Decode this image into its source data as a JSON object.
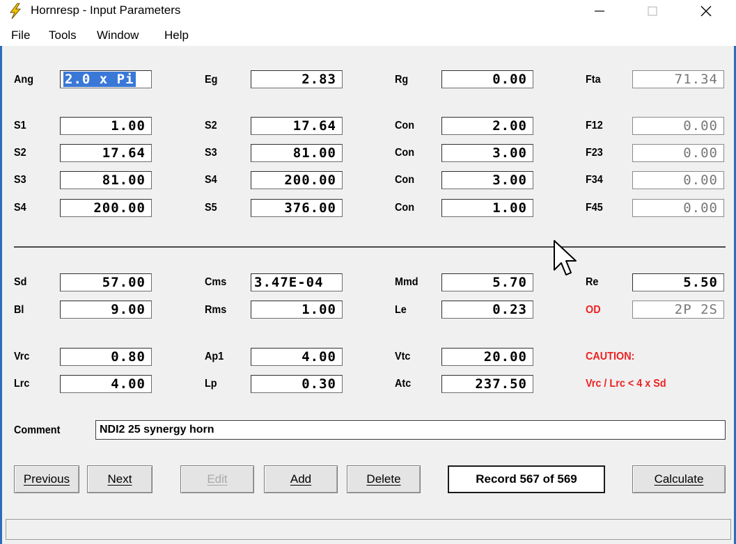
{
  "window": {
    "title": "Hornresp - Input Parameters"
  },
  "menu": {
    "file": "File",
    "tools": "Tools",
    "window": "Window",
    "help": "Help"
  },
  "params": {
    "ang": {
      "label": "Ang",
      "value": "2.0 x Pi"
    },
    "eg": {
      "label": "Eg",
      "value": "2.83"
    },
    "rg": {
      "label": "Rg",
      "value": "0.00"
    },
    "fta": {
      "label": "Fta",
      "value": "71.34"
    },
    "row1": [
      {
        "label": "S1",
        "value": "1.00"
      },
      {
        "label": "S2",
        "value": "17.64"
      },
      {
        "label": "Con",
        "value": "2.00"
      },
      {
        "label": "F12",
        "value": "0.00"
      }
    ],
    "row2": [
      {
        "label": "S2",
        "value": "17.64"
      },
      {
        "label": "S3",
        "value": "81.00"
      },
      {
        "label": "Con",
        "value": "3.00"
      },
      {
        "label": "F23",
        "value": "0.00"
      }
    ],
    "row3": [
      {
        "label": "S3",
        "value": "81.00"
      },
      {
        "label": "S4",
        "value": "200.00"
      },
      {
        "label": "Con",
        "value": "3.00"
      },
      {
        "label": "F34",
        "value": "0.00"
      }
    ],
    "row4": [
      {
        "label": "S4",
        "value": "200.00"
      },
      {
        "label": "S5",
        "value": "376.00"
      },
      {
        "label": "Con",
        "value": "1.00"
      },
      {
        "label": "F45",
        "value": "0.00"
      }
    ]
  },
  "driver": {
    "row1": [
      {
        "label": "Sd",
        "value": "57.00"
      },
      {
        "label": "Cms",
        "value": "3.47E-04"
      },
      {
        "label": "Mmd",
        "value": "5.70"
      },
      {
        "label": "Re",
        "value": "5.50"
      }
    ],
    "row2": [
      {
        "label": "Bl",
        "value": "9.00"
      },
      {
        "label": "Rms",
        "value": "1.00"
      },
      {
        "label": "Le",
        "value": "0.23"
      },
      {
        "label": "OD",
        "value": "2P 2S"
      }
    ]
  },
  "chambers": {
    "row1": [
      {
        "label": "Vrc",
        "value": "0.80"
      },
      {
        "label": "Ap1",
        "value": "4.00"
      },
      {
        "label": "Vtc",
        "value": "20.00"
      }
    ],
    "row2": [
      {
        "label": "Lrc",
        "value": "4.00"
      },
      {
        "label": "Lp",
        "value": "0.30"
      },
      {
        "label": "Atc",
        "value": "237.50"
      }
    ],
    "caution_title": "CAUTION:",
    "caution_text": "Vrc / Lrc < 4 x Sd"
  },
  "comment": {
    "label": "Comment",
    "value": "NDI2 25 synergy horn"
  },
  "buttons": {
    "previous": "Previous",
    "next": "Next",
    "edit": "Edit",
    "add": "Add",
    "delete": "Delete",
    "calculate": "Calculate"
  },
  "record": "Record 567 of 569",
  "colors": {
    "accent": "#3a78d8",
    "caution": "#ee2222",
    "window_border": "#2b6cb8"
  },
  "icons": {
    "app": "lightning-icon",
    "minimize": "minimize-icon",
    "maximize": "maximize-icon",
    "close": "close-icon",
    "pointer": "mouse-pointer-icon"
  }
}
